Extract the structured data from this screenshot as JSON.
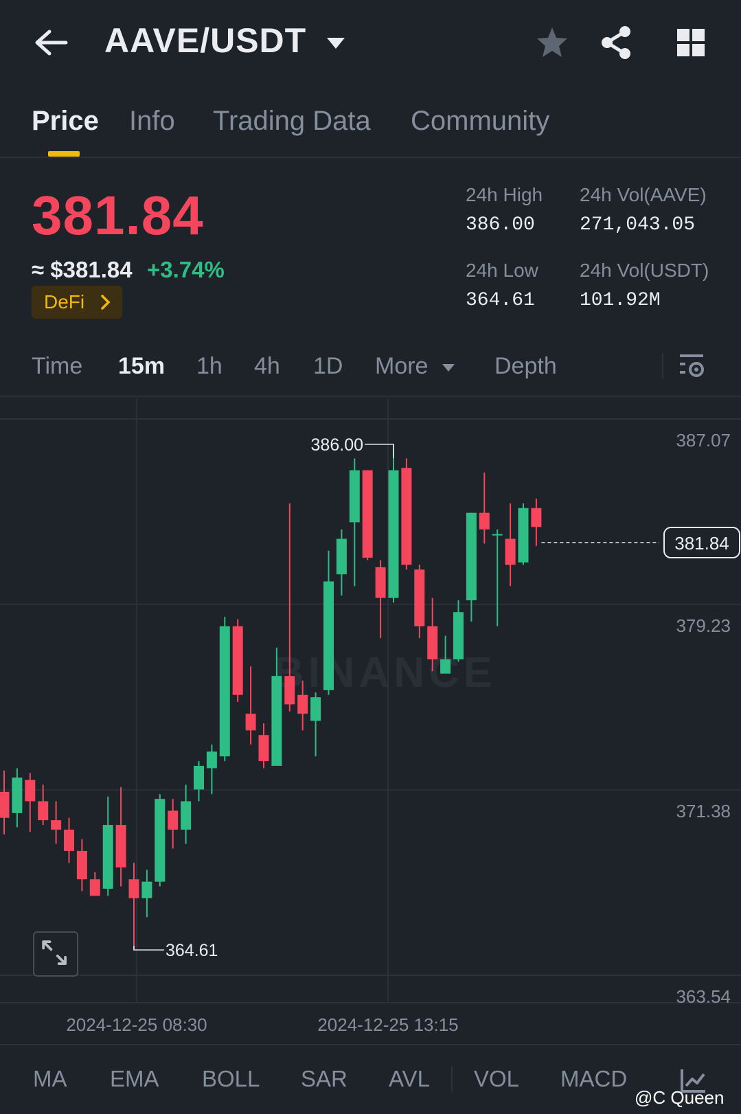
{
  "header": {
    "pair": "AAVE/USDT",
    "icons": [
      "back-arrow-icon",
      "caret-down-icon",
      "star-icon",
      "share-icon",
      "grid-icon"
    ]
  },
  "tabs": [
    {
      "label": "Price",
      "active": true
    },
    {
      "label": "Info",
      "active": false
    },
    {
      "label": "Trading Data",
      "active": false
    },
    {
      "label": "Community",
      "active": false
    }
  ],
  "price": {
    "last": "381.84",
    "approx": "≈ $381.84",
    "change": "+3.74%",
    "tag": "DeFi",
    "last_color": "#f6465d",
    "change_color": "#2ebd85"
  },
  "stats": {
    "high_label": "24h High",
    "high_value": "386.00",
    "low_label": "24h Low",
    "low_value": "364.61",
    "vol_base_label": "24h Vol(AAVE)",
    "vol_base_value": "271,043.05",
    "vol_quote_label": "24h Vol(USDT)",
    "vol_quote_value": "101.92M"
  },
  "intervals": {
    "time": "Time",
    "m15": "15m",
    "h1": "1h",
    "h4": "4h",
    "d1": "1D",
    "more": "More",
    "depth": "Depth",
    "active": "15m"
  },
  "chart_data": {
    "type": "candlestick",
    "y_axis_labels": [
      "387.07",
      "379.23",
      "371.38",
      "363.54"
    ],
    "y_axis_values": [
      387.07,
      379.23,
      371.38,
      363.54
    ],
    "ylim": [
      363.54,
      388.5
    ],
    "x_axis_labels": [
      "2024-12-25 08:30",
      "2024-12-25 13:15"
    ],
    "max_marker": "386.00",
    "min_marker": "364.61",
    "current_price_label": "381.84",
    "current_price": 381.84,
    "up_color": "#2ebd85",
    "down_color": "#f6465d",
    "watermark": "BINANCE",
    "candles": [
      {
        "o": 371.3,
        "h": 372.2,
        "l": 369.5,
        "c": 370.2
      },
      {
        "o": 370.4,
        "h": 372.3,
        "l": 369.8,
        "c": 371.9
      },
      {
        "o": 371.8,
        "h": 372.1,
        "l": 369.6,
        "c": 370.9
      },
      {
        "o": 370.9,
        "h": 371.6,
        "l": 369.9,
        "c": 370.1
      },
      {
        "o": 370.1,
        "h": 370.9,
        "l": 369.1,
        "c": 369.7
      },
      {
        "o": 369.7,
        "h": 370.2,
        "l": 368.3,
        "c": 368.8
      },
      {
        "o": 368.8,
        "h": 369.3,
        "l": 367.1,
        "c": 367.6
      },
      {
        "o": 367.6,
        "h": 367.9,
        "l": 366.9,
        "c": 366.9
      },
      {
        "o": 367.2,
        "h": 371.1,
        "l": 366.9,
        "c": 369.9
      },
      {
        "o": 369.9,
        "h": 371.5,
        "l": 367.3,
        "c": 368.1
      },
      {
        "o": 367.6,
        "h": 368.3,
        "l": 364.61,
        "c": 366.8
      },
      {
        "o": 366.8,
        "h": 368.0,
        "l": 366.0,
        "c": 367.5
      },
      {
        "o": 367.5,
        "h": 371.2,
        "l": 367.3,
        "c": 371.0
      },
      {
        "o": 370.5,
        "h": 371.0,
        "l": 368.9,
        "c": 369.7
      },
      {
        "o": 369.7,
        "h": 371.6,
        "l": 369.1,
        "c": 370.9
      },
      {
        "o": 371.4,
        "h": 372.6,
        "l": 370.9,
        "c": 372.4
      },
      {
        "o": 372.3,
        "h": 373.3,
        "l": 371.2,
        "c": 373.0
      },
      {
        "o": 372.8,
        "h": 378.7,
        "l": 372.6,
        "c": 378.3
      },
      {
        "o": 378.3,
        "h": 378.6,
        "l": 375.1,
        "c": 375.4
      },
      {
        "o": 374.6,
        "h": 376.6,
        "l": 373.3,
        "c": 373.9
      },
      {
        "o": 373.7,
        "h": 374.2,
        "l": 372.3,
        "c": 372.6
      },
      {
        "o": 372.4,
        "h": 377.4,
        "l": 372.4,
        "c": 376.2
      },
      {
        "o": 376.2,
        "h": 383.5,
        "l": 374.7,
        "c": 375.0
      },
      {
        "o": 375.4,
        "h": 376.0,
        "l": 373.9,
        "c": 374.6
      },
      {
        "o": 374.3,
        "h": 375.5,
        "l": 372.8,
        "c": 375.3
      },
      {
        "o": 375.6,
        "h": 381.5,
        "l": 375.4,
        "c": 380.2
      },
      {
        "o": 380.5,
        "h": 382.4,
        "l": 379.6,
        "c": 382.0
      },
      {
        "o": 382.7,
        "h": 385.4,
        "l": 380.0,
        "c": 384.9
      },
      {
        "o": 384.9,
        "h": 384.9,
        "l": 381.1,
        "c": 381.2
      },
      {
        "o": 380.8,
        "h": 381.1,
        "l": 377.8,
        "c": 379.5
      },
      {
        "o": 379.5,
        "h": 386.0,
        "l": 379.3,
        "c": 384.9
      },
      {
        "o": 385.0,
        "h": 385.4,
        "l": 380.7,
        "c": 380.9
      },
      {
        "o": 380.7,
        "h": 380.9,
        "l": 377.8,
        "c": 378.3
      },
      {
        "o": 378.3,
        "h": 379.5,
        "l": 376.4,
        "c": 376.9
      },
      {
        "o": 376.3,
        "h": 377.9,
        "l": 376.4,
        "c": 376.9
      },
      {
        "o": 376.9,
        "h": 379.4,
        "l": 376.8,
        "c": 378.9
      },
      {
        "o": 379.4,
        "h": 383.1,
        "l": 378.5,
        "c": 383.1
      },
      {
        "o": 383.1,
        "h": 384.8,
        "l": 381.8,
        "c": 382.4
      },
      {
        "o": 382.2,
        "h": 382.4,
        "l": 378.3,
        "c": 382.2
      },
      {
        "o": 382.0,
        "h": 383.5,
        "l": 380.0,
        "c": 380.9
      },
      {
        "o": 381.0,
        "h": 383.5,
        "l": 380.9,
        "c": 383.3
      },
      {
        "o": 383.3,
        "h": 383.7,
        "l": 381.7,
        "c": 382.5
      }
    ]
  },
  "indicators": {
    "ma": "MA",
    "ema": "EMA",
    "boll": "BOLL",
    "sar": "SAR",
    "avl": "AVL",
    "vol": "VOL",
    "macd": "MACD"
  },
  "watermark": "@C Queen"
}
